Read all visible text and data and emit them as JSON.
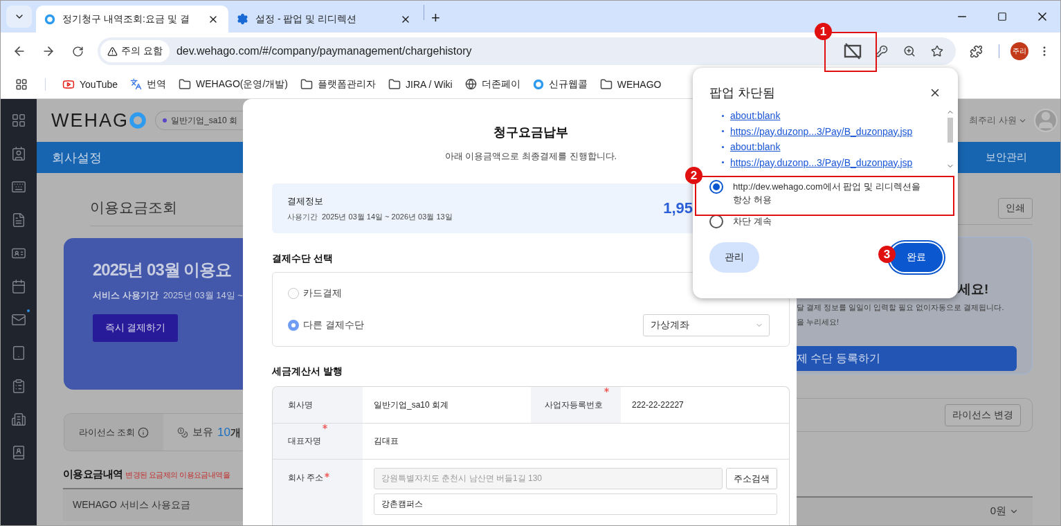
{
  "browser": {
    "tabs": [
      {
        "title": "정기청구 내역조회:요금 및 결",
        "kind": "ring",
        "selected": true
      },
      {
        "title": "설정 - 팝업 및 리디렉션",
        "kind": "gear",
        "selected": false
      }
    ],
    "new_tab": "+",
    "security_chip": "주의 요함",
    "url": "dev.wehago.com/#/company/paymanagement/chargehistory",
    "profile": "주리",
    "bookmarks": [
      {
        "label": "YouTube",
        "kind": "youtube"
      },
      {
        "label": "번역",
        "kind": "translate"
      },
      {
        "label": "WEHAGO(운영/개발)",
        "kind": "folder"
      },
      {
        "label": "플랫폼관리자",
        "kind": "folder"
      },
      {
        "label": "JIRA / Wiki",
        "kind": "folder"
      },
      {
        "label": "더존페이",
        "kind": "globe"
      },
      {
        "label": "신규웹콜",
        "kind": "ring"
      },
      {
        "label": "WEHAGO",
        "kind": "folder"
      }
    ]
  },
  "app": {
    "logo": "WEHAG",
    "company_badge": "일반기업_sa10 회",
    "user": "최주리 사원",
    "section_title": "회사설정",
    "right_menu": "보안관리",
    "page_title": "이용요금조회",
    "print_button": "인쇄",
    "bill_card": {
      "title": "2025년 03월 이용요",
      "period_label": "서비스 사용기간",
      "period": "2025년 03월 14일 ~",
      "pay_button": "즉시 결제하기"
    },
    "promo_card": {
      "title": "세요!",
      "lines": [
        "달 결제 정보를 일일이 입력할 필요 없이자동으로 결제됩니다.",
        "을 누리세요!"
      ],
      "button": "제 수단 등록하기"
    },
    "license": {
      "label": "라이선스 조회",
      "held_label": "보유",
      "held_count": "10",
      "held_unit": "개",
      "change_button": "라이선스 변경"
    },
    "history": {
      "title": "이용요금내역",
      "notice": "변경된 요금제의 이용요금내역을",
      "row_label": "WEHAGO 서비스 사용요금",
      "row_amount": "0원"
    }
  },
  "modal": {
    "title": "청구요금납부",
    "subtitle": "아래 이용금액으로 최종결제를 진행합니다.",
    "payment_info": {
      "label": "결제정보",
      "period_label": "사용기간",
      "period": "2025년 03월 14일 ~ 2026년 03월 13일",
      "amount": "1,95"
    },
    "method_title": "결제수단 선택",
    "methods": [
      {
        "label": "카드결제",
        "selected": false
      },
      {
        "label": "다른 결제수단",
        "selected": true,
        "select": "가상계좌"
      }
    ],
    "tax_title": "세금계산서 발행",
    "tax_rows": [
      [
        {
          "label": "회사명",
          "required": false,
          "value": "일반기업_sa10 회계"
        },
        {
          "label": "사업자등록번호",
          "required": true,
          "value": "222-22-22227"
        }
      ],
      [
        {
          "label": "대표자명",
          "required": true,
          "value": "김대표"
        }
      ]
    ],
    "address": {
      "label": "회사 주소",
      "required": true,
      "road": "강원특별자치도 춘천시 남산면 버들1길 130",
      "road_disabled": true,
      "search_button": "주소검색",
      "detail": "강촌캠퍼스"
    }
  },
  "popup": {
    "title": "팝업 차단됨",
    "links": [
      "about:blank",
      "https://pay.duzonp...3/Pay/B_duzonpay.jsp",
      "about:blank",
      "https://pay.duzonp...3/Pay/B_duzonpay.jsp"
    ],
    "options": [
      {
        "label": "http://dev.wehago.com에서 팝업 및 리디렉션을 항상 허용",
        "selected": true
      },
      {
        "label": "차단 계속",
        "selected": false
      }
    ],
    "manage_button": "관리",
    "done_button": "완료"
  },
  "annotations": [
    {
      "label": "1"
    },
    {
      "label": "2"
    },
    {
      "label": "3"
    }
  ]
}
